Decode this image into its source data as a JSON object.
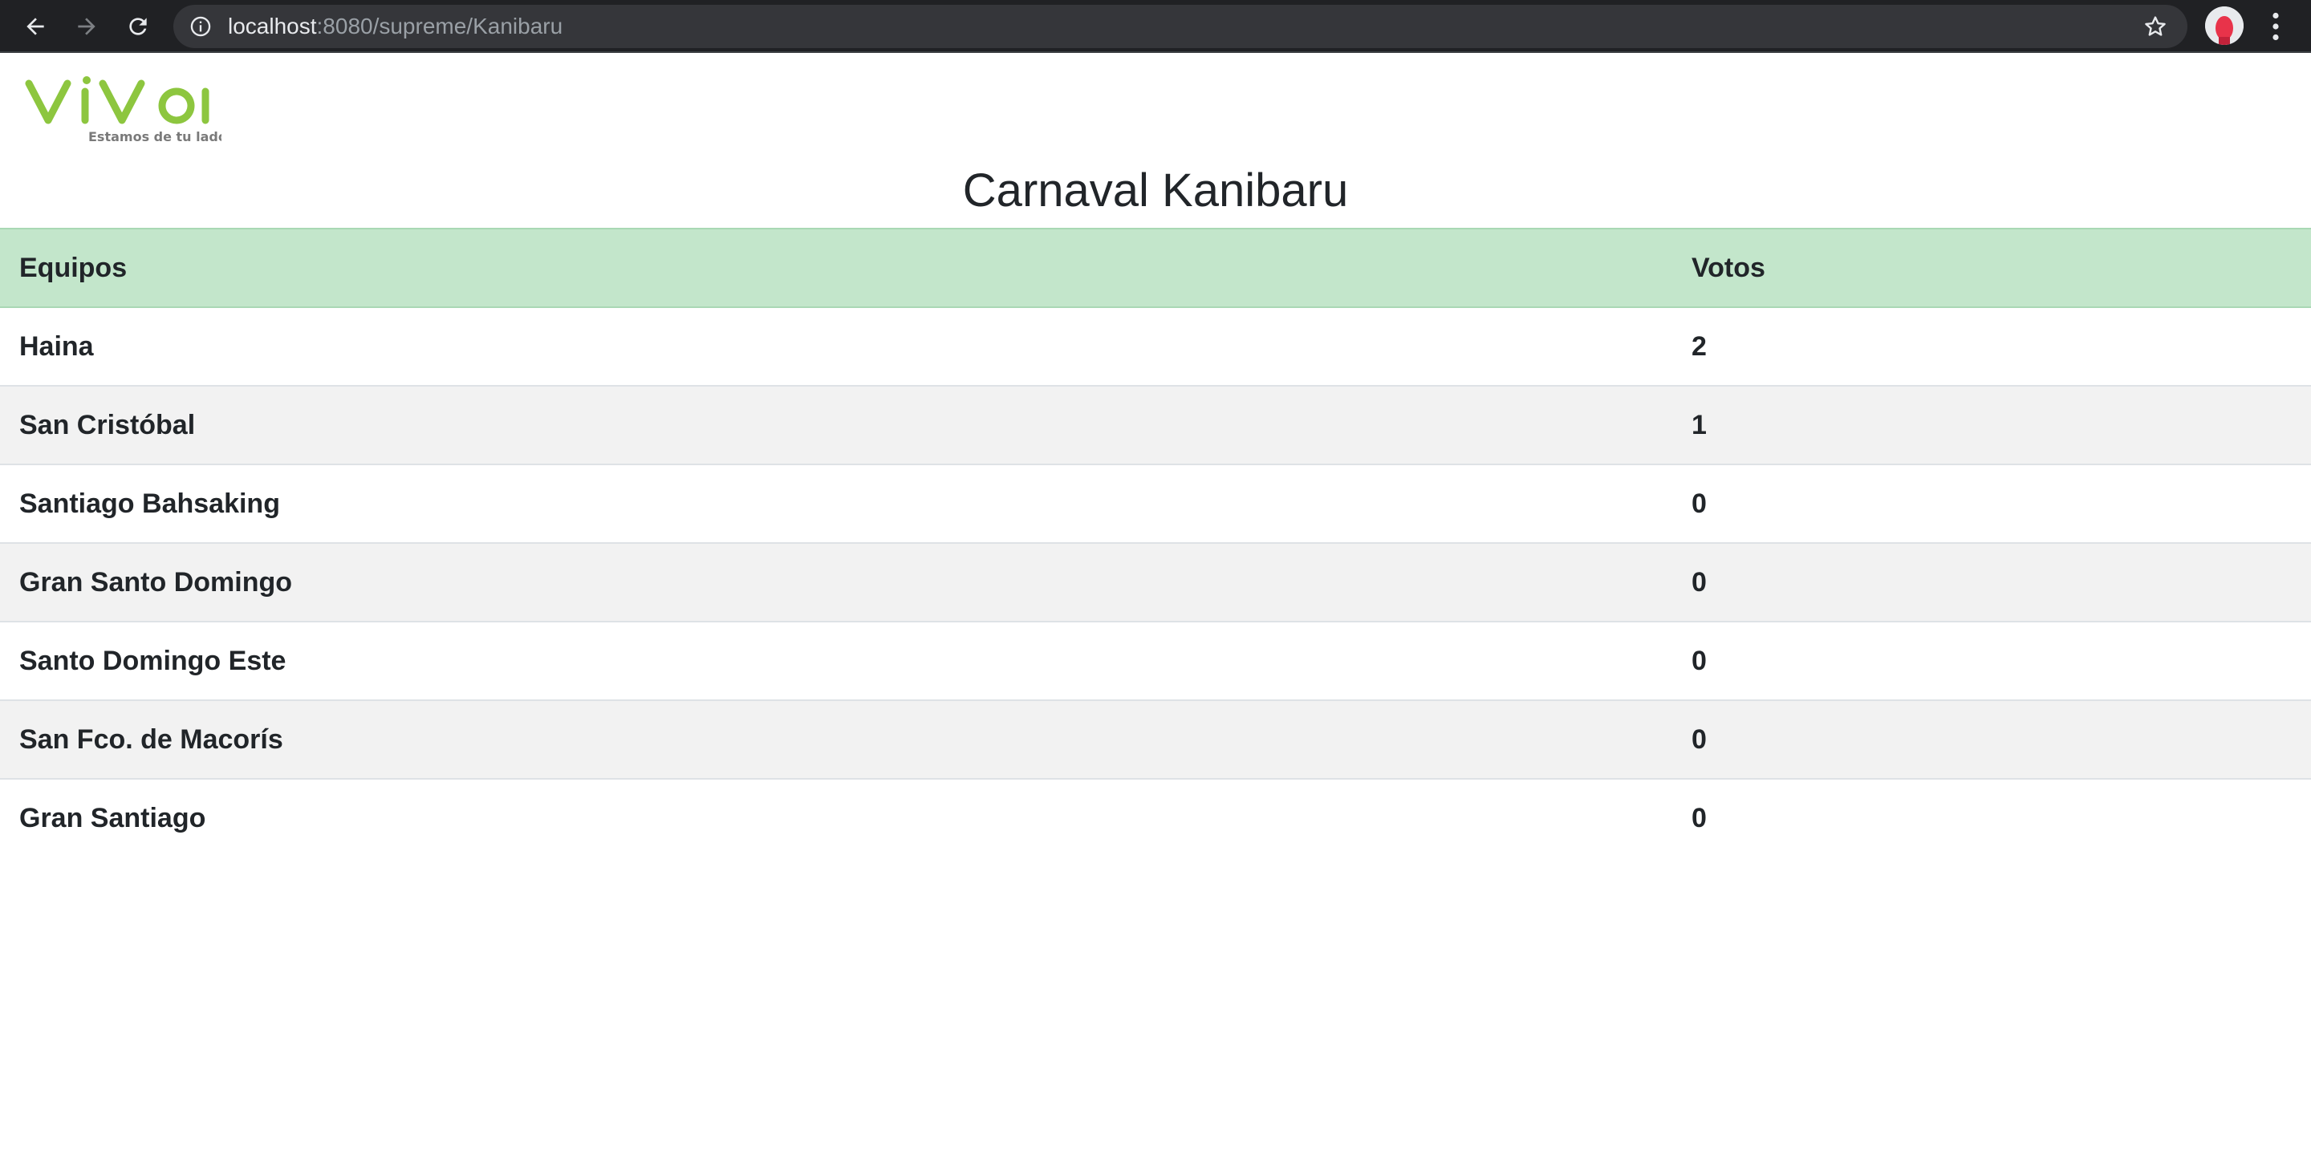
{
  "browser": {
    "url_host": "localhost",
    "url_rest": ":8080/supreme/Kanibaru"
  },
  "logo": {
    "brand": "viva",
    "tagline": "Estamos de tu lado",
    "brand_color": "#8dc63f"
  },
  "page": {
    "title": "Carnaval Kanibaru"
  },
  "table": {
    "headers": [
      "Equipos",
      "Votos"
    ],
    "rows": [
      {
        "team": "Haina",
        "votes": "2"
      },
      {
        "team": "San Cristóbal",
        "votes": "1"
      },
      {
        "team": "Santiago Bahsaking",
        "votes": "0"
      },
      {
        "team": "Gran Santo Domingo",
        "votes": "0"
      },
      {
        "team": "Santo Domingo Este",
        "votes": "0"
      },
      {
        "team": "San Fco. de Macorís",
        "votes": "0"
      },
      {
        "team": "Gran Santiago",
        "votes": "0"
      }
    ],
    "header_color": "#c3e6cb"
  }
}
